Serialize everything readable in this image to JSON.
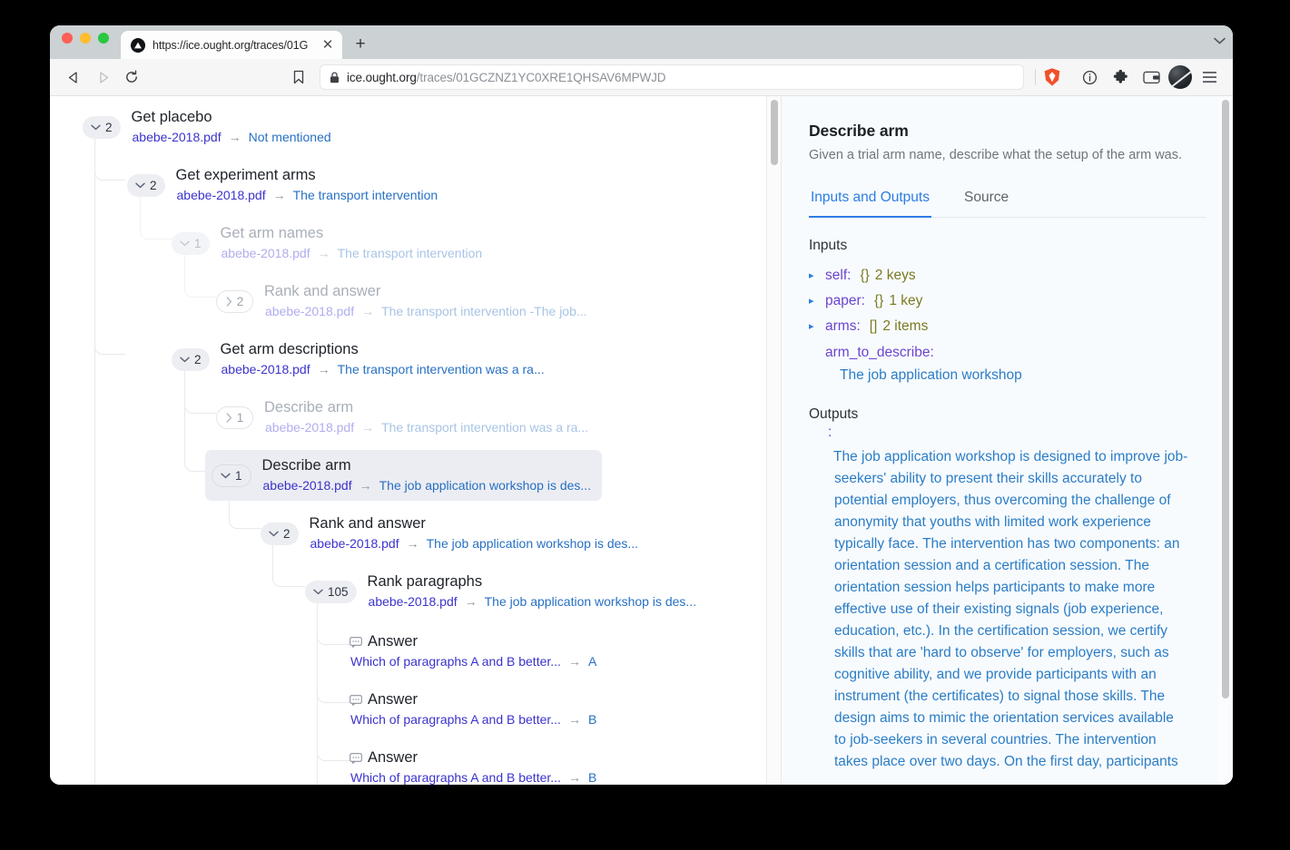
{
  "browser": {
    "tab_title": "https://ice.ought.org/traces/01G",
    "tab_close_icon": "close-icon",
    "newtab_label": "+",
    "tablist_chevron": "chevron-down-icon",
    "back_icon": "back-arrow-icon",
    "forward_icon": "forward-arrow-icon",
    "reload_icon": "reload-icon",
    "bookmark_icon": "bookmark-icon",
    "lock_icon": "lock-icon",
    "url_host": "ice.ought.org",
    "url_path": "/traces/01GCZNZ1YC0XRE1QHSAV6MPWJD",
    "shield_icon": "brave-shield-icon",
    "info_icon": "info-circle-icon",
    "extensions_icon": "puzzle-piece-icon",
    "wallet_icon": "wallet-icon",
    "profile_icon": "profile-avatar-icon",
    "menu_icon": "hamburger-menu-icon"
  },
  "tree": {
    "nodes": [
      {
        "title": "Get placebo",
        "count": "2",
        "chevron": "chevron-down-icon",
        "source": "abebe-2018.pdf",
        "arrow": "→",
        "value": "Not mentioned",
        "state": "normal"
      },
      {
        "title": "Get experiment arms",
        "count": "2",
        "chevron": "chevron-down-icon",
        "source": "abebe-2018.pdf",
        "arrow": "→",
        "value": "The transport intervention",
        "state": "normal"
      },
      {
        "title": "Get arm names",
        "count": "1",
        "chevron": "chevron-down-icon",
        "source": "abebe-2018.pdf",
        "arrow": "→",
        "value": "The transport intervention",
        "state": "dim"
      },
      {
        "title": "Rank and answer",
        "count": "2",
        "chevron": "chevron-right-icon",
        "source": "abebe-2018.pdf",
        "arrow": "→",
        "value": "The transport intervention -The job...",
        "state": "dim-collapsed"
      },
      {
        "title": "Get arm descriptions",
        "count": "2",
        "chevron": "chevron-down-icon",
        "source": "abebe-2018.pdf",
        "arrow": "→",
        "value": "The transport intervention was a ra...",
        "state": "normal"
      },
      {
        "title": "Describe arm",
        "count": "1",
        "chevron": "chevron-right-icon",
        "source": "abebe-2018.pdf",
        "arrow": "→",
        "value": "The transport intervention was a ra...",
        "state": "dim-collapsed"
      },
      {
        "title": "Describe arm",
        "count": "1",
        "chevron": "chevron-down-icon",
        "source": "abebe-2018.pdf",
        "arrow": "→",
        "value": "The job application workshop is des...",
        "state": "selected"
      },
      {
        "title": "Rank and answer",
        "count": "2",
        "chevron": "chevron-down-icon",
        "source": "abebe-2018.pdf",
        "arrow": "→",
        "value": "The job application workshop is des...",
        "state": "normal"
      },
      {
        "title": "Rank paragraphs",
        "count": "105",
        "chevron": "chevron-down-icon",
        "source": "abebe-2018.pdf",
        "arrow": "→",
        "value": "The job application workshop is des...",
        "state": "normal"
      }
    ],
    "answers": [
      {
        "icon": "chat-bubble-icon",
        "title": "Answer",
        "question": "Which of paragraphs A and B better...",
        "arrow": "→",
        "value": "A"
      },
      {
        "icon": "chat-bubble-icon",
        "title": "Answer",
        "question": "Which of paragraphs A and B better...",
        "arrow": "→",
        "value": "B"
      },
      {
        "icon": "chat-bubble-icon",
        "title": "Answer",
        "question": "Which of paragraphs A and B better...",
        "arrow": "→",
        "value": "B"
      }
    ]
  },
  "detail": {
    "title": "Describe arm",
    "description": "Given a trial arm name, describe what the setup of the arm was.",
    "tabs": [
      {
        "label": "Inputs and Outputs",
        "active": true
      },
      {
        "label": "Source",
        "active": false
      }
    ],
    "inputs_heading": "Inputs",
    "inputs": [
      {
        "triangle": "▸",
        "key": "self:",
        "type": "{}",
        "count": "2 keys"
      },
      {
        "triangle": "▸",
        "key": "paper:",
        "type": "{}",
        "count": "1 key"
      },
      {
        "triangle": "▸",
        "key": "arms:",
        "type": "[]",
        "count": "2 items"
      }
    ],
    "arm_to_describe_key": "arm_to_describe:",
    "arm_to_describe_value": "The job application workshop",
    "outputs_heading": "Outputs",
    "outputs_colon": ":",
    "outputs_text": "The job application workshop is designed to improve job-seekers' ability to present their skills accurately to potential employers, thus overcoming the challenge of anonymity that youths with limited work experience typically face. The intervention has two components: an orientation session and a certification session. The orientation session helps participants to make more effective use of their existing signals (job experience, education, etc.). In the certification session, we certify skills that are 'hard to observe' for employers, such as cognitive ability, and we provide participants with an instrument (the certificates) to signal those skills. The design aims to mimic the orientation services available to job-seekers in several countries. The intervention takes place over two days. On the first day, participants"
  }
}
